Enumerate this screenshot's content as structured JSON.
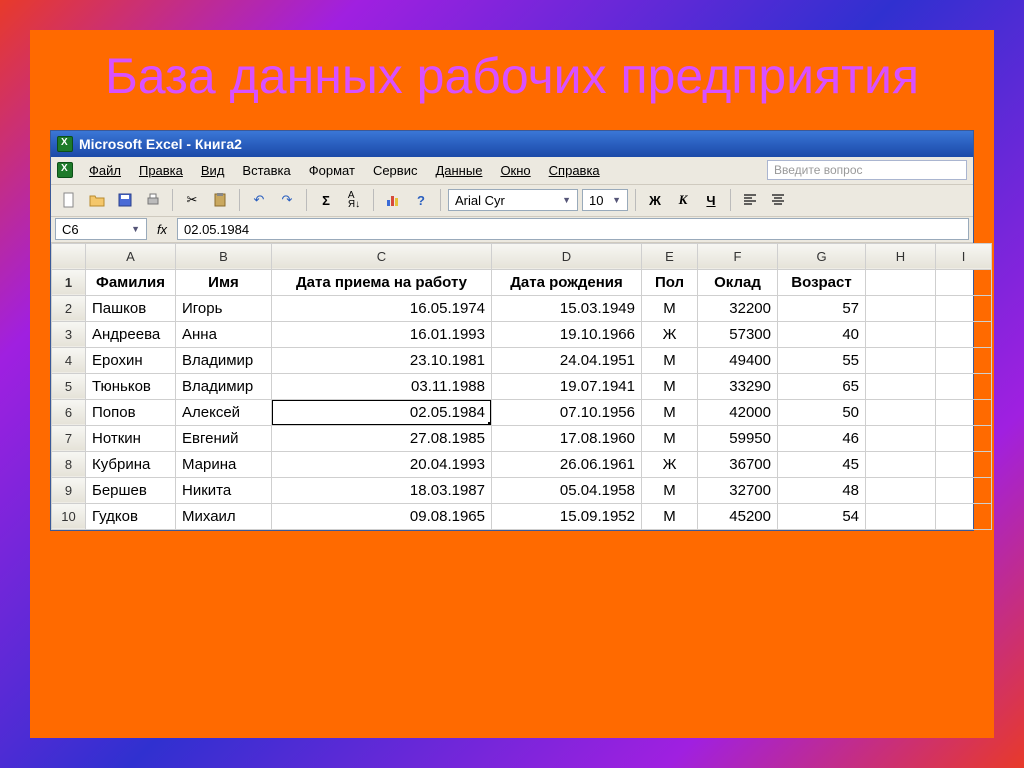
{
  "slide": {
    "title": "База данных рабочих предприятия"
  },
  "window": {
    "title": "Microsoft Excel - Книга2"
  },
  "menu": {
    "file": "Файл",
    "edit": "Правка",
    "view": "Вид",
    "insert": "Вставка",
    "format": "Формат",
    "tools": "Сервис",
    "data": "Данные",
    "window": "Окно",
    "help": "Справка",
    "help_placeholder": "Введите вопрос"
  },
  "format_bar": {
    "font": "Arial Cyr",
    "size": "10",
    "bold": "Ж",
    "italic": "К",
    "underline": "Ч"
  },
  "formula": {
    "cell_ref": "C6",
    "fx": "fx",
    "value": "02.05.1984"
  },
  "columns": [
    "A",
    "B",
    "C",
    "D",
    "E",
    "F",
    "G",
    "H",
    "I"
  ],
  "headers": {
    "A": "Фамилия",
    "B": "Имя",
    "C": "Дата приема на работу",
    "D": "Дата рождения",
    "E": "Пол",
    "F": "Оклад",
    "G": "Возраст"
  },
  "rows": [
    {
      "n": "2",
      "A": "Пашков",
      "B": "Игорь",
      "C": "16.05.1974",
      "D": "15.03.1949",
      "E": "М",
      "F": "32200",
      "G": "57"
    },
    {
      "n": "3",
      "A": "Андреева",
      "B": "Анна",
      "C": "16.01.1993",
      "D": "19.10.1966",
      "E": "Ж",
      "F": "57300",
      "G": "40"
    },
    {
      "n": "4",
      "A": "Ерохин",
      "B": "Владимир",
      "C": "23.10.1981",
      "D": "24.04.1951",
      "E": "М",
      "F": "49400",
      "G": "55"
    },
    {
      "n": "5",
      "A": "Тюньков",
      "B": "Владимир",
      "C": "03.11.1988",
      "D": "19.07.1941",
      "E": "М",
      "F": "33290",
      "G": "65"
    },
    {
      "n": "6",
      "A": "Попов",
      "B": "Алексей",
      "C": "02.05.1984",
      "D": "07.10.1956",
      "E": "М",
      "F": "42000",
      "G": "50"
    },
    {
      "n": "7",
      "A": "Ноткин",
      "B": "Евгений",
      "C": "27.08.1985",
      "D": "17.08.1960",
      "E": "М",
      "F": "59950",
      "G": "46"
    },
    {
      "n": "8",
      "A": "Кубрина",
      "B": "Марина",
      "C": "20.04.1993",
      "D": "26.06.1961",
      "E": "Ж",
      "F": "36700",
      "G": "45"
    },
    {
      "n": "9",
      "A": "Бершев",
      "B": "Никита",
      "C": "18.03.1987",
      "D": "05.04.1958",
      "E": "М",
      "F": "32700",
      "G": "48"
    },
    {
      "n": "10",
      "A": "Гудков",
      "B": "Михаил",
      "C": "09.08.1965",
      "D": "15.09.1952",
      "E": "М",
      "F": "45200",
      "G": "54"
    }
  ],
  "active_cell": "C6",
  "chart_data": {
    "type": "table",
    "title": "База данных рабочих предприятия",
    "columns": [
      "Фамилия",
      "Имя",
      "Дата приема на работу",
      "Дата рождения",
      "Пол",
      "Оклад",
      "Возраст"
    ],
    "rows": [
      [
        "Пашков",
        "Игорь",
        "16.05.1974",
        "15.03.1949",
        "М",
        32200,
        57
      ],
      [
        "Андреева",
        "Анна",
        "16.01.1993",
        "19.10.1966",
        "Ж",
        57300,
        40
      ],
      [
        "Ерохин",
        "Владимир",
        "23.10.1981",
        "24.04.1951",
        "М",
        49400,
        55
      ],
      [
        "Тюньков",
        "Владимир",
        "03.11.1988",
        "19.07.1941",
        "М",
        33290,
        65
      ],
      [
        "Попов",
        "Алексей",
        "02.05.1984",
        "07.10.1956",
        "М",
        42000,
        50
      ],
      [
        "Ноткин",
        "Евгений",
        "27.08.1985",
        "17.08.1960",
        "М",
        59950,
        46
      ],
      [
        "Кубрина",
        "Марина",
        "20.04.1993",
        "26.06.1961",
        "Ж",
        36700,
        45
      ],
      [
        "Бершев",
        "Никита",
        "18.03.1987",
        "05.04.1958",
        "М",
        32700,
        48
      ],
      [
        "Гудков",
        "Михаил",
        "09.08.1965",
        "15.09.1952",
        "М",
        45200,
        54
      ]
    ]
  }
}
